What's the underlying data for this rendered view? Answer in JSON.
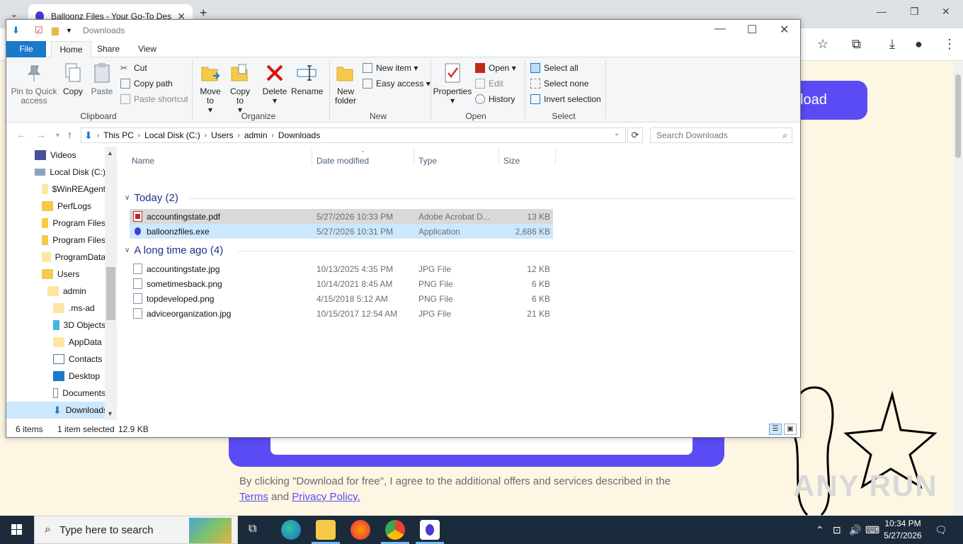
{
  "browser": {
    "tab_title": "Balloonz Files - Your Go-To Des",
    "page": {
      "download_button": "load",
      "consent_text": "By clicking \"Download for free\", I agree to the additional offers and services described in the",
      "terms_link": "Terms",
      "and_text": "and",
      "privacy_link": "Privacy Policy."
    }
  },
  "explorer": {
    "window_title": "Downloads",
    "ribbon_tabs": [
      "File",
      "Home",
      "Share",
      "View"
    ],
    "clipboard": {
      "pin": "Pin to Quick access",
      "copy": "Copy",
      "paste": "Paste",
      "cut": "Cut",
      "copy_path": "Copy path",
      "paste_shortcut": "Paste shortcut",
      "label": "Clipboard"
    },
    "organize": {
      "move_to": "Move to",
      "copy_to": "Copy to",
      "delete": "Delete",
      "rename": "Rename",
      "label": "Organize"
    },
    "new_group": {
      "new_folder": "New folder",
      "new_item": "New item",
      "easy_access": "Easy access",
      "label": "New"
    },
    "open_group": {
      "properties": "Properties",
      "open": "Open",
      "edit": "Edit",
      "history": "History",
      "label": "Open"
    },
    "select_group": {
      "select_all": "Select all",
      "select_none": "Select none",
      "invert": "Invert selection",
      "label": "Select"
    },
    "breadcrumb": [
      "This PC",
      "Local Disk (C:)",
      "Users",
      "admin",
      "Downloads"
    ],
    "search_placeholder": "Search Downloads",
    "nav_items": [
      "Videos",
      "Local Disk (C:)",
      "$WinREAgent",
      "PerfLogs",
      "Program Files",
      "Program Files",
      "ProgramData",
      "Users",
      "admin",
      ".ms-ad",
      "3D Objects",
      "AppData",
      "Contacts",
      "Desktop",
      "Documents",
      "Downloads"
    ],
    "columns": {
      "name": "Name",
      "date": "Date modified",
      "type": "Type",
      "size": "Size"
    },
    "groups": [
      {
        "label": "Today (2)",
        "files": [
          {
            "name": "accountingstate.pdf",
            "date": "5/27/2026 10:33 PM",
            "type": "Adobe Acrobat D...",
            "size": "13 KB"
          },
          {
            "name": "balloonzfiles.exe",
            "date": "5/27/2026 10:31 PM",
            "type": "Application",
            "size": "2,686 KB"
          }
        ]
      },
      {
        "label": "A long time ago (4)",
        "files": [
          {
            "name": "accountingstate.jpg",
            "date": "10/13/2025 4:35 PM",
            "type": "JPG File",
            "size": "12 KB"
          },
          {
            "name": "sometimesback.png",
            "date": "10/14/2021 8:45 AM",
            "type": "PNG File",
            "size": "6 KB"
          },
          {
            "name": "topdeveloped.png",
            "date": "4/15/2018 5:12 AM",
            "type": "PNG File",
            "size": "6 KB"
          },
          {
            "name": "adviceorganization.jpg",
            "date": "10/15/2017 12:54 AM",
            "type": "JPG File",
            "size": "21 KB"
          }
        ]
      }
    ],
    "status": {
      "items": "6 items",
      "selected": "1 item selected",
      "selected_size": "12.9 KB"
    }
  },
  "taskbar": {
    "search_placeholder": "Type here to search",
    "time": "10:34 PM",
    "date": "5/27/2026"
  }
}
